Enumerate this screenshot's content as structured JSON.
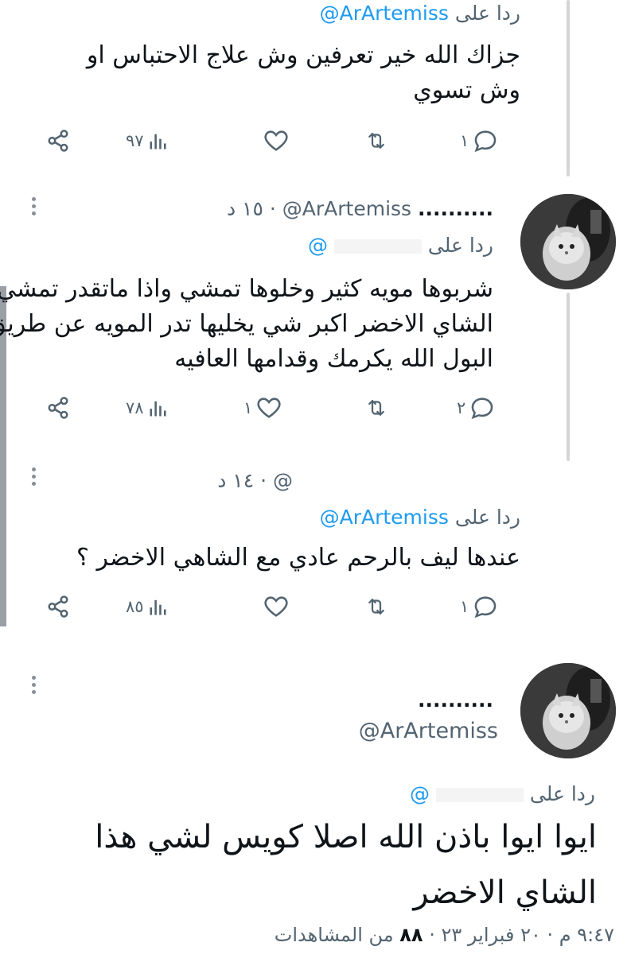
{
  "tweet1": {
    "reply_prefix": "ردا على",
    "reply_handle": "@ArArtemiss",
    "text": "جزاك الله خير تعرفين وش علاج الاحتباس او وش تسوي",
    "replies": "١",
    "retweets": "",
    "likes": "",
    "views": "٩٧"
  },
  "tweet2": {
    "display_name": "..........",
    "handle": "@ArArtemiss",
    "time": "١٥ د",
    "separator": "·",
    "reply_prefix": "ردا على",
    "reply_handle": "@",
    "text_line1": "شربوها مويه كثير وخلوها تمشي واذا ماتقدر تمشي",
    "text_line2": "الشاي الاخضر اكبر شي يخليها تدر المويه عن طريق",
    "text_line3": "البول الله يكرمك وقدامها العافيه",
    "replies": "٢",
    "retweets": "",
    "likes": "١",
    "views": "٧٨"
  },
  "tweet3": {
    "handle": "@",
    "time": "١٤ د",
    "separator": "·",
    "reply_prefix": "ردا على",
    "reply_handle": "@ArArtemiss",
    "text": "عندها ليف بالرحم عادي مع الشاهي الاخضر ؟",
    "replies": "١",
    "retweets": "",
    "likes": "",
    "views": "٨٥"
  },
  "main_tweet": {
    "display_name": "..........",
    "handle": "@ArArtemiss",
    "reply_prefix": "ردا على",
    "reply_handle": "@",
    "text_line1": "ايوا ايوا باذن الله اصلا كويس لشي هذا",
    "text_line2": "الشاي الاخضر",
    "timestamp": "٩:٤٧ م · ٢٠ فبراير ٢٣ ·",
    "views_count": "٨٨",
    "views_label": "من المشاهدات"
  },
  "icons": {
    "share": "share-icon",
    "views": "views-icon",
    "like": "heart-icon",
    "retweet": "retweet-icon",
    "reply": "reply-icon",
    "more": "more-vertical-icon"
  },
  "colors": {
    "accent": "#1d9bf0",
    "muted": "#536471",
    "text": "#0f1419"
  }
}
